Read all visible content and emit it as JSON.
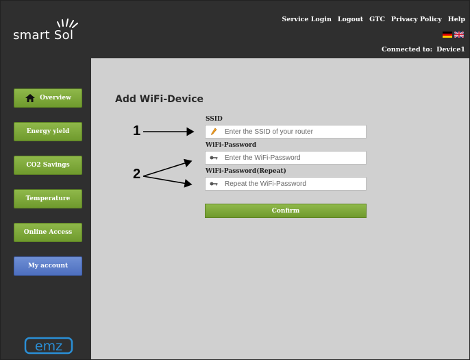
{
  "brand": {
    "logo_text": "smart Sol",
    "footer_logo_text": "emz"
  },
  "header": {
    "nav": [
      "Service Login",
      "Logout",
      "GTC",
      "Privacy Policy",
      "Help"
    ],
    "connected_label": "Connected to:",
    "connected_device": "Device1",
    "flags": [
      "german-flag-icon",
      "uk-flag-icon"
    ]
  },
  "sidebar": {
    "items": [
      {
        "label": "Overview",
        "icon": "home-icon",
        "color": "#7aa637"
      },
      {
        "label": "Energy yield",
        "color": "#7aa637"
      },
      {
        "label": "CO2 Savings",
        "color": "#7aa637"
      },
      {
        "label": "Temperature",
        "color": "#7aa637"
      },
      {
        "label": "Online Access",
        "color": "#7aa637"
      },
      {
        "label": "My account",
        "color": "#5a7ccb"
      }
    ]
  },
  "main": {
    "title": "Add WiFi-Device",
    "ssid": {
      "label": "SSID",
      "placeholder": "Enter the SSID of your router",
      "icon": "pencil-icon"
    },
    "password": {
      "label": "WiFi-Password",
      "placeholder": "Enter the WiFi-Password",
      "icon": "key-icon"
    },
    "password_repeat": {
      "label": "WiFi-Password(Repeat)",
      "placeholder": "Repeat the WiFi-Password",
      "icon": "key-icon"
    },
    "confirm_label": "Confirm"
  },
  "callouts": {
    "one": "1",
    "two": "2"
  }
}
